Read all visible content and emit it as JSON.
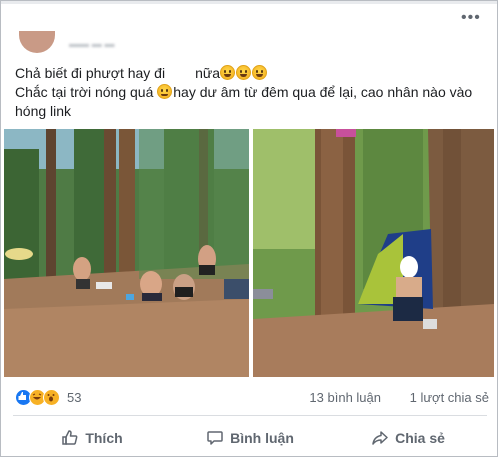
{
  "post": {
    "line1": "Chả biết đi phượt hay đi",
    "line1_tail": "nữa",
    "line2": "Chắc tại trời nóng quá",
    "line2_tail": "hay dư âm từ đêm qua để lại, cao nhân nào vào",
    "line3": "hóng link"
  },
  "stats": {
    "reactions_count": "53",
    "comments": "13 bình luận",
    "shares": "1 lượt chia sẻ"
  },
  "actions": {
    "like": "Thích",
    "comment": "Bình luận",
    "share": "Chia sẻ"
  },
  "icons": [
    "more-icon",
    "avatar",
    "like-reaction-icon",
    "haha-reaction-icon",
    "wow-reaction-icon",
    "like-icon",
    "comment-icon",
    "share-icon"
  ],
  "colors": {
    "like_blue": "#1877f2",
    "reaction_yellow": "#f7b125",
    "meta_gray": "#606770"
  }
}
